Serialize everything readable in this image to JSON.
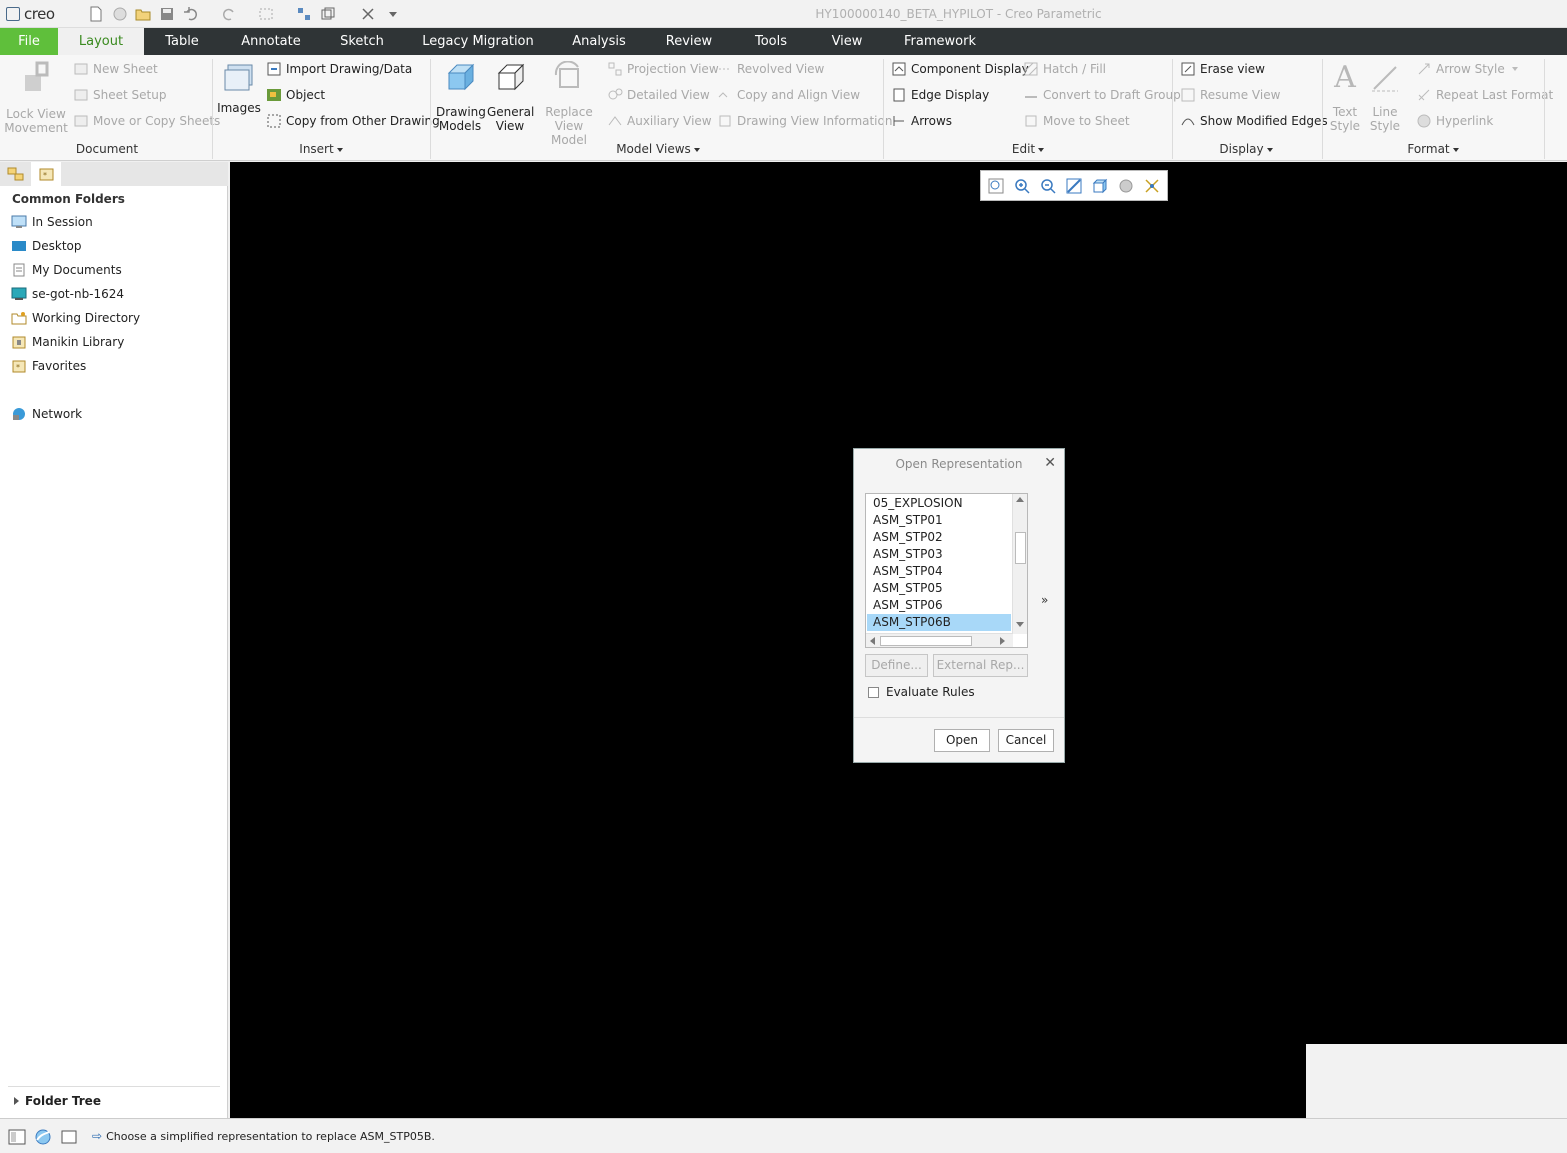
{
  "app": {
    "logo_text": "creo",
    "window_title": "HY100000140_BETA_HYPILOT - Creo Parametric"
  },
  "tabs": [
    "File",
    "Layout",
    "Table",
    "Annotate",
    "Sketch",
    "Legacy Migration",
    "Analysis",
    "Review",
    "Tools",
    "View",
    "Framework"
  ],
  "ribbon": {
    "document": {
      "lock_view_movement": "Lock View Movement",
      "lock_view_l1": "Lock View",
      "lock_view_l2": "Movement",
      "new_sheet": "New Sheet",
      "sheet_setup": "Sheet Setup",
      "move_copy_sheets": "Move or Copy Sheets",
      "label": "Document"
    },
    "insert": {
      "images": "Images",
      "import_drawing": "Import Drawing/Data",
      "object": "Object",
      "copy_from_other": "Copy from Other Drawing",
      "label": "Insert"
    },
    "model_views": {
      "drawing_models_l1": "Drawing",
      "drawing_models_l2": "Models",
      "general_view_l1": "General",
      "general_view_l2": "View",
      "replace_view_l1": "Replace",
      "replace_view_l2": "View Model",
      "projection_view": "Projection View",
      "detailed_view": "Detailed View",
      "auxiliary_view": "Auxiliary View",
      "revolved_view": "Revolved View",
      "copy_align_view": "Copy and Align View",
      "drawing_view_info": "Drawing View Information",
      "label": "Model Views"
    },
    "edit": {
      "component_display": "Component Display",
      "edge_display": "Edge Display",
      "arrows": "Arrows",
      "hatch_fill": "Hatch / Fill",
      "convert_draft": "Convert to Draft Group",
      "move_to_sheet": "Move to Sheet",
      "label": "Edit"
    },
    "display": {
      "erase_view": "Erase view",
      "resume_view": "Resume View",
      "show_modified_edges": "Show Modified Edges",
      "label": "Display"
    },
    "format": {
      "text_style_l1": "Text",
      "text_style_l2": "Style",
      "line_style_l1": "Line",
      "line_style_l2": "Style",
      "arrow_style": "Arrow Style",
      "repeat_last_format": "Repeat Last Format",
      "hyperlink": "Hyperlink",
      "label": "Format"
    }
  },
  "navigator": {
    "common_folders": "Common Folders",
    "items": [
      "In Session",
      "Desktop",
      "My Documents",
      "se-got-nb-1624",
      "Working Directory",
      "Manikin Library",
      "Favorites"
    ],
    "network": "Network",
    "folder_tree": "Folder Tree"
  },
  "dialog": {
    "title": "Open Representation",
    "reps": [
      "05_EXPLOSION",
      "ASM_STP01",
      "ASM_STP02",
      "ASM_STP03",
      "ASM_STP04",
      "ASM_STP05",
      "ASM_STP06",
      "ASM_STP06B"
    ],
    "selected": "ASM_STP06B",
    "define_btn": "Define...",
    "external_btn": "External Rep...",
    "evaluate_rules": "Evaluate Rules",
    "expand": "»",
    "open_btn": "Open",
    "cancel_btn": "Cancel"
  },
  "status": {
    "message": "Choose a simplified representation to replace ASM_STP05B."
  },
  "colors": {
    "file_tab": "#5fbf3b",
    "tabbar": "#2f3436",
    "selection": "#a8d8f8",
    "canvas": "#000000"
  }
}
